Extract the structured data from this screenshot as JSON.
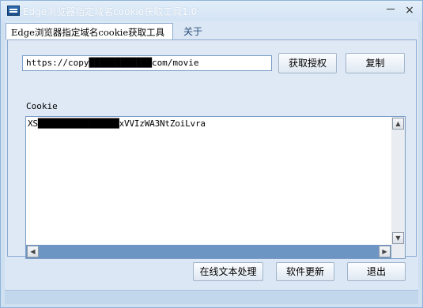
{
  "window": {
    "title": "Edge浏览器指定域名cookie获取工具1.0"
  },
  "title_buttons": {
    "minimize": "－",
    "close": "×"
  },
  "tabs": [
    {
      "label": "Edge浏览器指定域名cookie获取工具"
    },
    {
      "label": "关于"
    }
  ],
  "url_field": {
    "value": "https://copy████████████com/movie"
  },
  "buttons": {
    "auth": "获取授权",
    "copy": "复制",
    "online": "在线文本处理",
    "update": "软件更新",
    "exit": "退出"
  },
  "cookie": {
    "label": "Cookie",
    "value": "XS████████████████xVVIzWA3NtZoiLvra"
  },
  "scroll": {
    "up": "▲",
    "down": "▼",
    "left": "◀",
    "right": "▶"
  }
}
